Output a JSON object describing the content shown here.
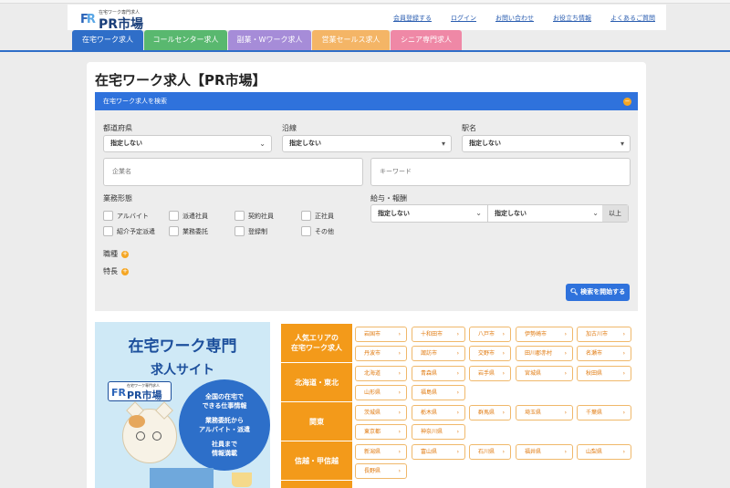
{
  "header": {
    "logo_sub": "在宅ワーク専門求人",
    "logo_main": "PR市場",
    "nav": [
      "会員登録する",
      "ログイン",
      "お問い合わせ",
      "お役立ち情報",
      "よくあるご質問"
    ]
  },
  "tabs": [
    "在宅ワーク求人",
    "コールセンター求人",
    "副業・Wワーク求人",
    "営業セールス求人",
    "シニア専門求人"
  ],
  "page_title": "在宅ワーク求人【PR市場】",
  "search": {
    "panel_title": "在宅ワーク求人を検索",
    "prefecture_label": "都道府県",
    "prefecture_value": "指定しない",
    "line_label": "沿線",
    "line_value": "指定しない",
    "station_label": "駅名",
    "station_value": "指定しない",
    "company_placeholder": "企業名",
    "keyword_placeholder": "キーワード",
    "employment_label": "業務形態",
    "employment_options": [
      "アルバイト",
      "派遣社員",
      "契約社員",
      "正社員",
      "紹介予定派遣",
      "業務委託",
      "登録制",
      "その他"
    ],
    "salary_label": "給与・報酬",
    "salary_from": "指定しない",
    "salary_to": "指定しない",
    "salary_suffix": "以上",
    "job_type_label": "職種",
    "feature_label": "特長",
    "submit_label": "検索を開始する"
  },
  "banner": {
    "line1": "在宅ワーク専門",
    "line2": "求人サイト",
    "logo_sub": "在宅ワーク専門求人",
    "logo_main": "PR市場",
    "circle1": "全国の在宅で",
    "circle2": "できる仕事情報",
    "circle3": "業務委託から",
    "circle4": "アルバイト・派遣",
    "circle5": "社員まで",
    "circle6": "情報満載"
  },
  "areas": [
    {
      "title": "人気エリアの\n在宅ワーク求人",
      "cities": [
        "岩国市",
        "十和田市",
        "八戸市",
        "伊勢崎市",
        "加古川市",
        "丹波市",
        "諏訪市",
        "交野市",
        "田川郡赤村",
        "名瀬市"
      ]
    },
    {
      "title": "北海道・東北",
      "cities": [
        "北海道",
        "青森県",
        "岩手県",
        "宮城県",
        "秋田県",
        "山形県",
        "福島県"
      ]
    },
    {
      "title": "関東",
      "cities": [
        "茨城県",
        "栃木県",
        "群馬県",
        "埼玉県",
        "千葉県",
        "東京都",
        "神奈川県"
      ]
    },
    {
      "title": "信越・甲信越",
      "cities": [
        "新潟県",
        "富山県",
        "石川県",
        "福井県",
        "山梨県",
        "長野県"
      ]
    },
    {
      "title": "",
      "cities": []
    }
  ]
}
